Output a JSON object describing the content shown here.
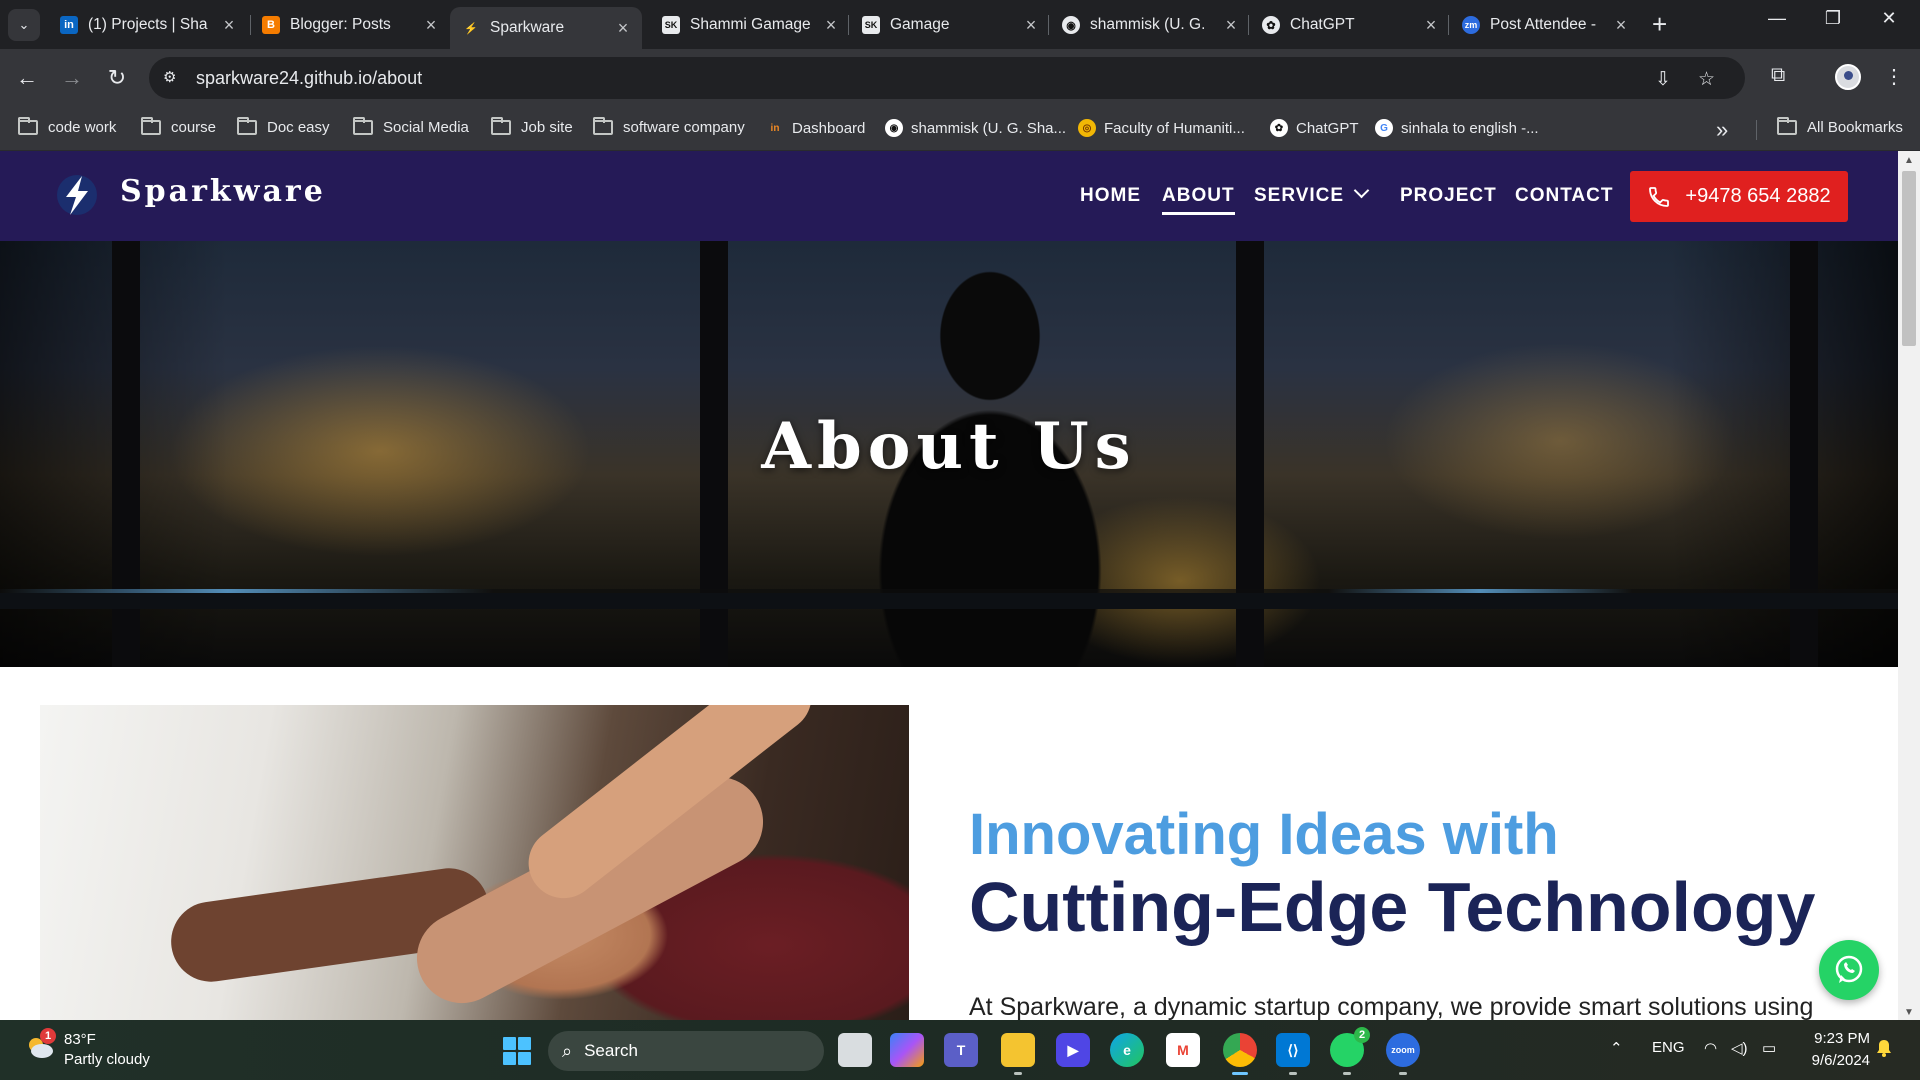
{
  "browser": {
    "tabs": [
      {
        "label": "(1) Projects | Sha",
        "favicon": "in",
        "favicon_color": "#0a66c2"
      },
      {
        "label": "Blogger: Posts",
        "favicon": "B",
        "favicon_color": "#f57c00"
      },
      {
        "label": "Sparkware",
        "favicon": "⚡",
        "favicon_color": "#1b2457",
        "active": true
      },
      {
        "label": "Shammi Gamage",
        "favicon": "SK",
        "favicon_color": "#222222"
      },
      {
        "label": "Gamage",
        "favicon": "SK",
        "favicon_color": "#222222"
      },
      {
        "label": "shammisk (U. G.",
        "favicon": "◉",
        "favicon_color": "#24292f"
      },
      {
        "label": "ChatGPT",
        "favicon": "✿",
        "favicon_color": "#444444"
      },
      {
        "label": "Post Attendee -",
        "favicon": "zm",
        "favicon_color": "#2d6cdf"
      }
    ],
    "url": "sparkware24.github.io/about",
    "bookmarks": [
      {
        "label": "code work",
        "type": "folder"
      },
      {
        "label": "course",
        "type": "folder"
      },
      {
        "label": "Doc easy",
        "type": "folder"
      },
      {
        "label": "Social Media",
        "type": "folder"
      },
      {
        "label": "Job site",
        "type": "folder"
      },
      {
        "label": "software company",
        "type": "folder"
      },
      {
        "label": "Dashboard",
        "type": "site",
        "icon": "in",
        "color": "#f08a24"
      },
      {
        "label": "shammisk (U. G. Sha...",
        "type": "site",
        "icon": "◉",
        "color": "#ffffff"
      },
      {
        "label": "Faculty of Humaniti...",
        "type": "site",
        "icon": "◎",
        "color": "#f2b705"
      },
      {
        "label": "ChatGPT",
        "type": "site",
        "icon": "✿",
        "color": "#ffffff"
      },
      {
        "label": "sinhala to english -...",
        "type": "site",
        "icon": "G",
        "color": "#ffffff"
      }
    ],
    "all_bookmarks": "All Bookmarks"
  },
  "site": {
    "brand": "Sparkware",
    "nav": [
      "HOME",
      "ABOUT",
      "SERVICE",
      "PROJECT",
      "CONTACT"
    ],
    "active_nav": "ABOUT",
    "phone": "+9478 654 2882",
    "hero_title": "About Us",
    "tagline_1": "Innovating Ideas with",
    "tagline_2": "Cutting-Edge Technology",
    "intro": "At Sparkware, a dynamic startup company, we provide smart solutions using",
    "colors": {
      "header_bg": "#251a57",
      "call_button": "#e0201f",
      "tagline_1": "#4d9de0",
      "tagline_2": "#1b2457",
      "whatsapp": "#25d366"
    }
  },
  "taskbar": {
    "weather_temp": "83°F",
    "weather_desc": "Partly cloudy",
    "weather_badge": "1",
    "search_placeholder": "Search",
    "whatsapp_badge": "2",
    "language": "ENG",
    "time": "9:23 PM",
    "date": "9/6/2024"
  }
}
